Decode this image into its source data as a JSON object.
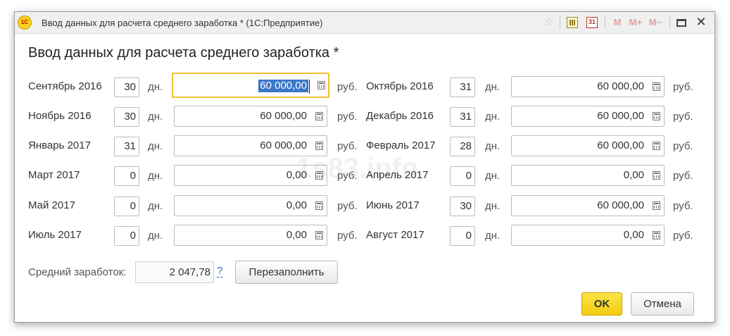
{
  "window": {
    "title": "Ввод данных для расчета среднего заработка * (1С:Предприятие)",
    "logo": "1С",
    "toolbar": {
      "star_icon": "☆",
      "calendar_icon_text": "31",
      "m_label": "M",
      "m_plus_label": "M+",
      "m_minus_label": "M−",
      "close_glyph": "✕"
    }
  },
  "heading": "Ввод данных для расчета среднего заработка *",
  "days_unit": "дн.",
  "currency_unit": "руб.",
  "months": [
    {
      "label": "Сентябрь 2016",
      "days": "30",
      "amount": "60 000,00"
    },
    {
      "label": "Октябрь 2016",
      "days": "31",
      "amount": "60 000,00"
    },
    {
      "label": "Ноябрь 2016",
      "days": "30",
      "amount": "60 000,00"
    },
    {
      "label": "Декабрь 2016",
      "days": "31",
      "amount": "60 000,00"
    },
    {
      "label": "Январь 2017",
      "days": "31",
      "amount": "60 000,00"
    },
    {
      "label": "Февраль 2017",
      "days": "28",
      "amount": "60 000,00"
    },
    {
      "label": "Март 2017",
      "days": "0",
      "amount": "0,00"
    },
    {
      "label": "Апрель 2017",
      "days": "0",
      "amount": "0,00"
    },
    {
      "label": "Май 2017",
      "days": "0",
      "amount": "0,00"
    },
    {
      "label": "Июнь 2017",
      "days": "30",
      "amount": "60 000,00"
    },
    {
      "label": "Июль 2017",
      "days": "0",
      "amount": "0,00"
    },
    {
      "label": "Август 2017",
      "days": "0",
      "amount": "0,00"
    }
  ],
  "average": {
    "label": "Средний заработок:",
    "value": "2 047,78",
    "help": "?"
  },
  "buttons": {
    "refill": "Перезаполнить",
    "ok": "OK",
    "cancel": "Отмена"
  },
  "watermark": "1s83.info",
  "colors": {
    "ok_button": "#f2cc10",
    "focus_border": "#f0c030",
    "selection": "#3a77c9",
    "link": "#2a6ec9"
  }
}
